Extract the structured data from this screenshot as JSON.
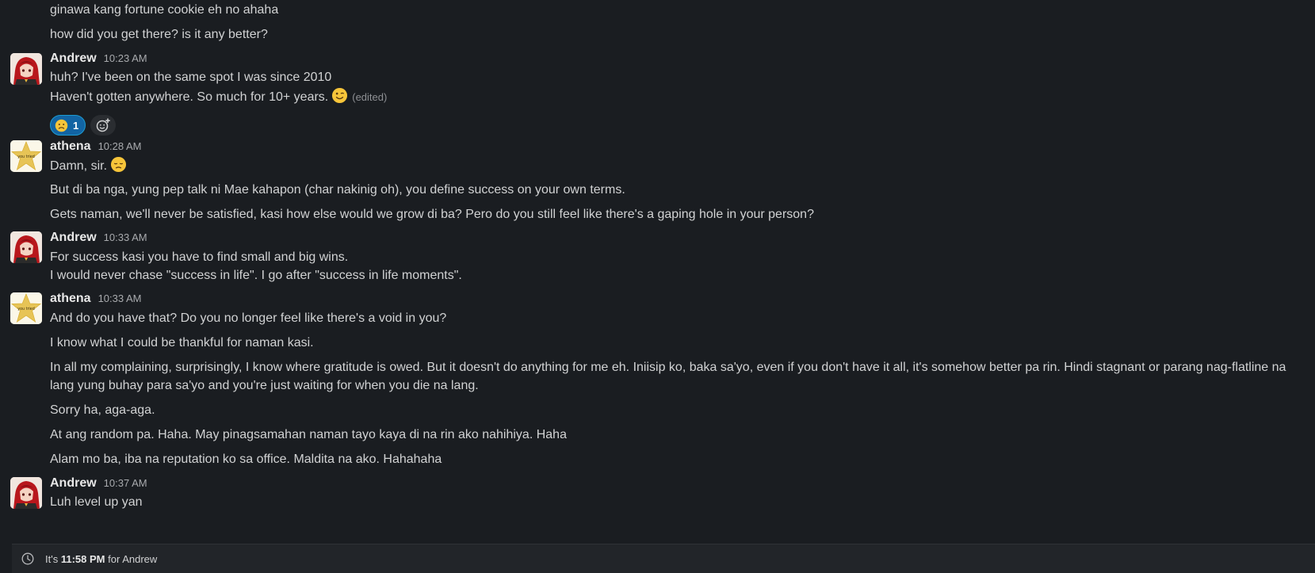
{
  "messages": {
    "prev_line_1": "ginawa kang fortune cookie eh no ahaha",
    "prev_line_2": "how did you get there? is it any better?",
    "m1": {
      "author": "Andrew",
      "time": "10:23 AM",
      "line_1": "huh? I've been on the same spot I was since 2010",
      "line_2": "Haven't gotten anywhere. So much for 10+ years.",
      "emoji": "wink-emoji",
      "edited": "(edited)",
      "reaction_emoji": "worried-face-emoji",
      "reaction_count": "1"
    },
    "m2": {
      "author": "athena",
      "time": "10:28 AM",
      "line_1": "Damn, sir.",
      "emoji": "disappointed-face-emoji",
      "line_2": "But di ba nga, yung pep talk ni Mae kahapon (char nakinig oh), you define success on your own terms.",
      "line_3": "Gets naman, we'll never be satisfied, kasi how else would we grow di ba? Pero do you still feel like there's a gaping hole in your person?"
    },
    "m3": {
      "author": "Andrew",
      "time": "10:33 AM",
      "line_1": "For success kasi you have to find small and big wins.",
      "line_2": "I would never chase \"success in life\". I go after \"success in life moments\"."
    },
    "m4": {
      "author": "athena",
      "time": "10:33 AM",
      "line_1": "And do you have that? Do you no longer feel like there's a void in you?",
      "line_2": "I know what I could be thankful for naman kasi.",
      "line_3a": "In all my complaining, surprisingly, I know where gratitude is owed. But it doesn't do anything for me eh. Iniisip ko, baka sa'yo, even if you don't have it all, it's somehow better pa rin. Hindi stagnant or parang nag-flatline na",
      "line_3b": "lang yung buhay para sa'yo and you're just waiting for when you die na lang.",
      "line_4": "Sorry ha, aga-aga.",
      "line_5": "At ang random pa. Haha. May pinagsamahan naman tayo kaya di na rin ako nahihiya. Haha",
      "line_6": "Alam mo ba, iba na reputation ko sa office. Maldita na ako. Hahahaha"
    },
    "m5": {
      "author": "Andrew",
      "time": "10:37 AM",
      "line_1": "Luh level up yan"
    }
  },
  "avatar_text": "you tried",
  "footer": {
    "icon": "clock-icon",
    "prefix": "It's",
    "time": "11:58 PM",
    "suffix": "for Andrew"
  },
  "colors": {
    "background": "#1a1d21",
    "text": "#d1d2d3",
    "reaction_bg": "#1264a3",
    "footer_bg": "#222529"
  }
}
